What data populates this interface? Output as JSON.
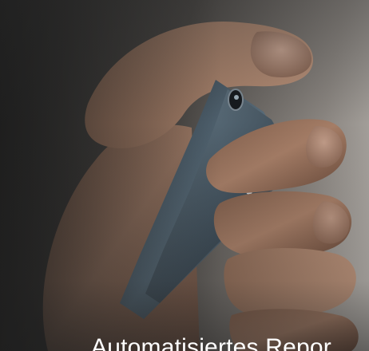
{
  "hero": {
    "caption": "Automatisiertes Repor",
    "image_subject": "hand-holding-phone-icon",
    "colors": {
      "background_dark": "#2c2c2b",
      "background_light": "#b7b3ae",
      "caption_text": "#ffffff"
    }
  }
}
